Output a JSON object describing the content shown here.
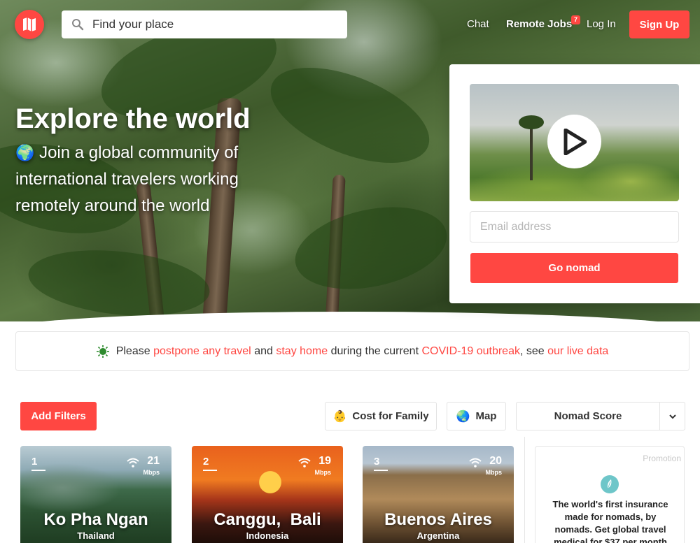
{
  "header": {
    "search_placeholder": "Find your place",
    "nav": {
      "chat": "Chat",
      "remote_jobs": "Remote Jobs",
      "remote_jobs_badge": "7",
      "login": "Log In",
      "signup": "Sign Up"
    }
  },
  "hero": {
    "title": "Explore the world",
    "subtitle_icon": "🌍",
    "subtitle": "Join a global community of international travelers working remotely around the world"
  },
  "signup_card": {
    "email_placeholder": "Email address",
    "cta": "Go nomad"
  },
  "banner": {
    "icon": "virus-icon",
    "text_1": "Please",
    "link_1": "postpone any travel",
    "text_2": "and",
    "link_2": "stay home",
    "text_3": "during the current",
    "link_3": "COVID-19 outbreak",
    "text_4": ", see",
    "link_4": "our live data"
  },
  "filters": {
    "add_filters": "Add Filters",
    "family_icon": "👶",
    "family": "Cost for Family",
    "map_icon": "🌏",
    "map": "Map",
    "sort": "Nomad Score"
  },
  "cities": [
    {
      "rank": "1",
      "speed": "21",
      "unit": "Mbps",
      "name": "Ko Pha Ngan",
      "country": "Thailand"
    },
    {
      "rank": "2",
      "speed": "19",
      "unit": "Mbps",
      "name": "Canggu,  Bali",
      "country": "Indonesia"
    },
    {
      "rank": "3",
      "speed": "20",
      "unit": "Mbps",
      "name": "Buenos Aires",
      "country": "Argentina"
    }
  ],
  "promo": {
    "tag": "Promotion",
    "text": "The world's first insurance made for nomads, by nomads. Get global travel medical for $37 per month"
  },
  "colors": {
    "accent": "#ff4742",
    "promo_icon": "#6ec6c9"
  }
}
